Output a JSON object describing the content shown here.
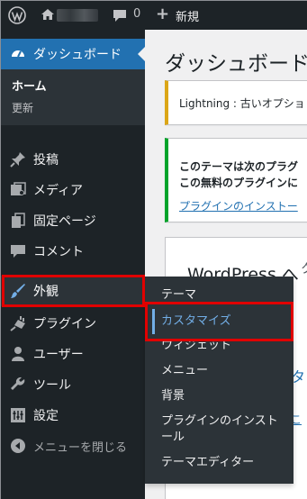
{
  "adminbar": {
    "wp_icon": "wordpress-icon",
    "home_icon": "home-icon",
    "comment_icon": "comment-icon",
    "comment_count": "0",
    "new_icon": "plus-icon",
    "new_label": "新規"
  },
  "sidebar": {
    "dashboard": {
      "icon": "dashboard-icon",
      "label": "ダッシュボード"
    },
    "home_label": "ホーム",
    "updates_label": "更新",
    "items": [
      {
        "icon": "pin-icon",
        "label": "投稿"
      },
      {
        "icon": "media-icon",
        "label": "メディア"
      },
      {
        "icon": "page-icon",
        "label": "固定ページ"
      },
      {
        "icon": "comment-icon",
        "label": "コメント"
      },
      {
        "icon": "brush-icon",
        "label": "外観"
      },
      {
        "icon": "plugin-icon",
        "label": "プラグイン"
      },
      {
        "icon": "user-icon",
        "label": "ユーザー"
      },
      {
        "icon": "wrench-icon",
        "label": "ツール"
      },
      {
        "icon": "settings-icon",
        "label": "設定"
      },
      {
        "icon": "collapse-icon",
        "label": "メニューを閉じる"
      }
    ]
  },
  "flyout": {
    "items": [
      "テーマ",
      "カスタマイズ",
      "ウィジェット",
      "メニュー",
      "背景",
      "プラグインのインスト",
      "ール",
      "テーマエディター"
    ]
  },
  "main": {
    "title": "ダッシュボード",
    "notice1": "Lightning : 古いオプショ",
    "notice2_line1": "このテーマは次のプラグ",
    "notice2_line2": "この無料のプラグインに",
    "notice2_link": "プラグインのインストー",
    "welcome_heading": "WordPress へ",
    "welcome_close": "ク",
    "welcome_btn": "タ",
    "welcome_link": "こ"
  },
  "colors": {
    "bar": "#1d2327",
    "accent": "#2271b1",
    "flyout_active": "#72aee6",
    "highlight": "#e00000"
  }
}
